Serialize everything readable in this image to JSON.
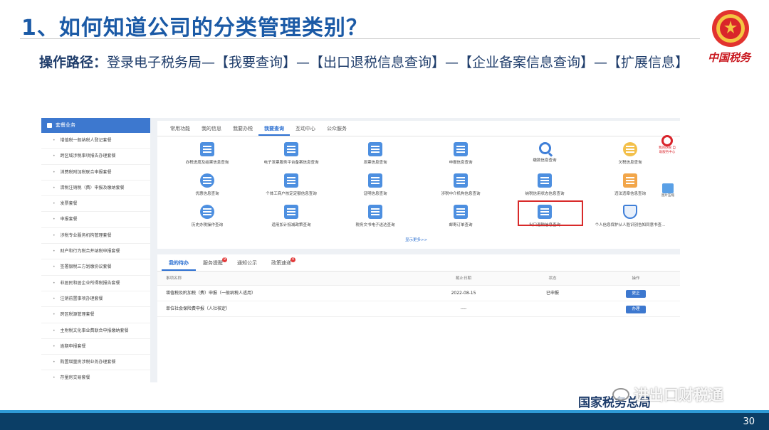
{
  "slide": {
    "title": "1、如何知道公司的分类管理类别？",
    "path_label": "操作路径：",
    "path_text": "登录电子税务局—【我要查询】—【出口退税信息查询】—【企业备案信息查询】—【扩展信息】",
    "brand": "中国税务",
    "footer": "国家税务总局",
    "watermark": "进出口财税通",
    "page_number": "30"
  },
  "sidebar": {
    "header": "套餐业务",
    "items": [
      "增值税一般纳税人登记套餐",
      "跨区域涉税事项报告办理套餐",
      "消费税附加税联合申报套餐",
      "清税注销税（费）申报及缴纳套餐",
      "发票套餐",
      "申报套餐",
      "涉税专业服务机构管理套餐",
      "财产和行为税合并纳税申报套餐",
      "签署银税三方划缴协议套餐",
      "非居民和居企业所得税报告套餐",
      "注销前置事项办理套餐",
      "跨区税源管理套餐",
      "主附税文化事业费联合申报缴纳套餐",
      "逾期申报套餐",
      "购置增量房涉税业务办理套餐",
      "存量房交易套餐"
    ]
  },
  "top_tabs": [
    "常用功能",
    "我的信息",
    "我要办税",
    "我要查询",
    "互动中心",
    "公众服务"
  ],
  "query_items": [
    {
      "label": "办税进度及结果信息查询",
      "icon": "progress-icon"
    },
    {
      "label": "电子发票服务平台备案信息查询",
      "icon": "invoice-icon"
    },
    {
      "label": "发票信息查询",
      "icon": "invoice-search-icon"
    },
    {
      "label": "申报信息查询",
      "icon": "declare-icon"
    },
    {
      "label": "缴款信息查询",
      "icon": "search-icon"
    },
    {
      "label": "欠税信息查询",
      "icon": "debt-icon"
    },
    {
      "label": "优惠信息查询",
      "icon": "discount-icon"
    },
    {
      "label": "个体工商户核定定额信息查询",
      "icon": "quota-icon"
    },
    {
      "label": "证明信息查询",
      "icon": "certificate-icon"
    },
    {
      "label": "涉税中介机构信息查询",
      "icon": "agency-icon"
    },
    {
      "label": "纳税信用状态信息查询",
      "icon": "credit-icon"
    },
    {
      "label": "违法违章信息查询",
      "icon": "violation-icon"
    },
    {
      "label": "历史办税操作查询",
      "icon": "history-icon"
    },
    {
      "label": "适用加计抵减政策查询",
      "icon": "policy-icon"
    },
    {
      "label": "税务文书电子送达查询",
      "icon": "document-icon"
    },
    {
      "label": "邮寄订单查询",
      "icon": "mail-icon"
    },
    {
      "label": "出口退税信息查询",
      "icon": "export-refund-icon"
    },
    {
      "label": "个人信息保护从人脸识别告知同意书查...",
      "icon": "shield-icon"
    }
  ],
  "show_more": "显示更多>>",
  "side_logo_text": "我的办税 自助服务中心",
  "side_image_text": "图片压缩",
  "bottom_tabs": [
    {
      "label": "我的待办",
      "badge": ""
    },
    {
      "label": "服务提醒",
      "badge": "9"
    },
    {
      "label": "通知公示",
      "badge": ""
    },
    {
      "label": "政策速递",
      "badge": "4"
    }
  ],
  "todo_table": {
    "headers": [
      "事项名称",
      "截止日期",
      "状态",
      "操作"
    ],
    "rows": [
      {
        "name": "增值税及附加税（费）申报（一般纳税人适用）",
        "date": "2022-08-15",
        "status": "已申报",
        "action": "更正"
      },
      {
        "name": "单位社会保险费申报（人社核定）",
        "date": "----",
        "status": "",
        "action": "办理"
      }
    ]
  }
}
